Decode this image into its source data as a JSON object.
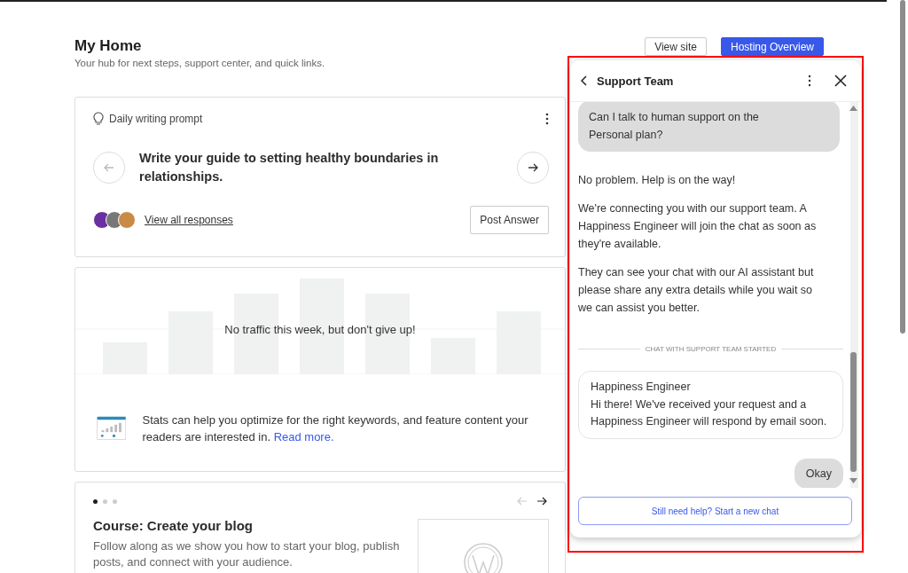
{
  "header": {
    "title": "My Home",
    "subtitle": "Your hub for next steps, support center, and quick links.",
    "buttons": [
      {
        "label": "View site",
        "kind": "secondary"
      },
      {
        "label": "Hosting Overview",
        "kind": "primary"
      }
    ]
  },
  "prompt_card": {
    "label": "Daily writing prompt",
    "prompt": "Write your guide to setting healthy boundaries in relationships.",
    "responses_link": "View all responses",
    "post_button": "Post Answer"
  },
  "stats_card": {
    "empty_message": "No traffic this week, but don't give up!",
    "tip": "Stats can help you optimize for the right keywords, and feature content your readers are interested in.",
    "tip_link": "Read more."
  },
  "course_card": {
    "dots": [
      {
        "selected": true
      },
      {
        "selected": false
      },
      {
        "selected": false
      }
    ],
    "title": "Course: Create your blog",
    "description": "Follow along as we show you how to start your blog, publish posts, and connect with your audience."
  },
  "chat": {
    "title": "Support Team",
    "messages": [
      {
        "kind": "user",
        "text": "Can I talk to human support on the Personal plan?"
      },
      {
        "kind": "bot",
        "text": "No problem. Help is on the way!"
      },
      {
        "kind": "bot",
        "text": "We're connecting you with our support team. A Happiness Engineer will join the chat as soon as they're available."
      },
      {
        "kind": "bot",
        "text": "They can see your chat with our AI assistant but please share any extra details while you wait so we can assist you better."
      },
      {
        "kind": "divider",
        "text": "CHAT WITH SUPPORT TEAM STARTED"
      },
      {
        "kind": "agent",
        "sender": "Happiness Engineer",
        "text": "Hi there! We've received your request and a Happiness Engineer will respond by email soon."
      },
      {
        "kind": "user",
        "text": "Okay"
      }
    ],
    "new_chat_button": "Still need help? Start a new chat"
  }
}
